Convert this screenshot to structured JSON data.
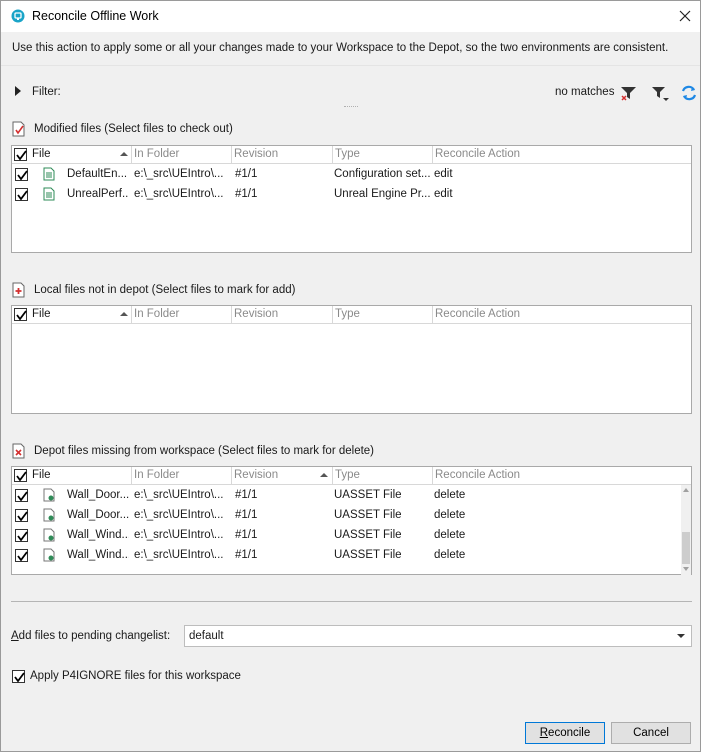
{
  "window": {
    "title": "Reconcile Offline Work"
  },
  "intro": "Use this action to apply some or all your changes made to your Workspace to the Depot, so the two environments are consistent.",
  "filter": {
    "label": "Filter:",
    "status": "no matches"
  },
  "columns": {
    "file": "File",
    "folder": "In Folder",
    "revision": "Revision",
    "type": "Type",
    "action": "Reconcile Action"
  },
  "modified": {
    "heading": "Modified files (Select files to check out)",
    "rows": [
      {
        "file": "DefaultEn...",
        "folder": "e:\\_src\\UEIntro\\...",
        "revision": "#1/1",
        "type": "Configuration set...",
        "action": "edit"
      },
      {
        "file": "UnrealPerf...",
        "folder": "e:\\_src\\UEIntro\\...",
        "revision": "#1/1",
        "type": "Unreal Engine Pr...",
        "action": "edit"
      }
    ]
  },
  "local": {
    "heading": "Local files not in depot (Select files to mark for add)",
    "rows": []
  },
  "missing": {
    "heading": "Depot files missing from workspace (Select files to mark for delete)",
    "rows": [
      {
        "file": "Wall_Door...",
        "folder": "e:\\_src\\UEIntro\\...",
        "revision": "#1/1",
        "type": "UASSET File",
        "action": "delete"
      },
      {
        "file": "Wall_Door...",
        "folder": "e:\\_src\\UEIntro\\...",
        "revision": "#1/1",
        "type": "UASSET File",
        "action": "delete"
      },
      {
        "file": "Wall_Wind...",
        "folder": "e:\\_src\\UEIntro\\...",
        "revision": "#1/1",
        "type": "UASSET File",
        "action": "delete"
      },
      {
        "file": "Wall_Wind...",
        "folder": "e:\\_src\\UEIntro\\...",
        "revision": "#1/1",
        "type": "UASSET File",
        "action": "delete"
      }
    ]
  },
  "changelist": {
    "label_prefix": "A",
    "label_rest": "dd files to pending changelist:",
    "value": "default"
  },
  "p4ignore": {
    "label": "Apply P4IGNORE files for this workspace",
    "checked": true
  },
  "buttons": {
    "reconcile_ul": "R",
    "reconcile_rest": "econcile",
    "cancel": "Cancel"
  },
  "colors": {
    "accent": "#0078d7",
    "close_red": "#d32f2f",
    "filter_refresh": "#1e88e5"
  }
}
